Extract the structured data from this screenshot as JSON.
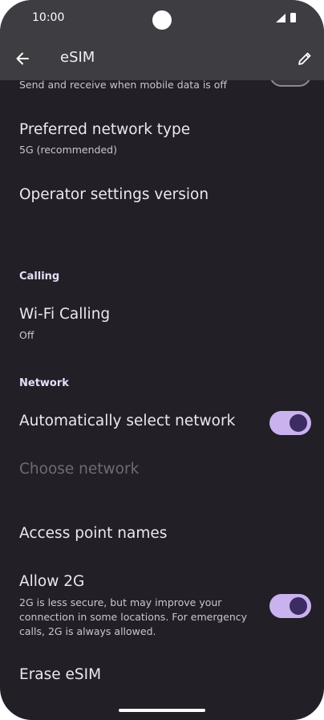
{
  "status_bar": {
    "time": "10:00",
    "signal_icon": "cell-signal-icon",
    "battery_icon": "battery-icon"
  },
  "app_bar": {
    "title": "eSIM",
    "back_icon": "arrow-back-icon",
    "edit_icon": "pencil-icon"
  },
  "settings": {
    "data_roaming_summary": "Send and receive when mobile data is off",
    "preferred_network": {
      "title": "Preferred network type",
      "summary": "5G (recommended)"
    },
    "operator_settings": {
      "title": "Operator settings version"
    },
    "calling_header": "Calling",
    "wifi_calling": {
      "title": "Wi-Fi Calling",
      "summary": "Off"
    },
    "network_header": "Network",
    "auto_select": {
      "title": "Automatically select network",
      "toggle_on": true
    },
    "choose_network": {
      "title": "Choose network",
      "enabled": false
    },
    "access_point_names": {
      "title": "Access point names"
    },
    "allow_2g": {
      "title": "Allow 2G",
      "summary": "2G is less secure, but may improve your connection in some locations. For emergency calls, 2G is always allowed.",
      "toggle_on": true
    },
    "erase_esim": {
      "title": "Erase eSIM"
    }
  },
  "colors": {
    "background": "#221f27",
    "app_bar": "#3e3d42",
    "toggle_track_on": "#c9b2ee",
    "toggle_thumb_on": "#3d2b63",
    "section_header": "#e8ddf7"
  }
}
